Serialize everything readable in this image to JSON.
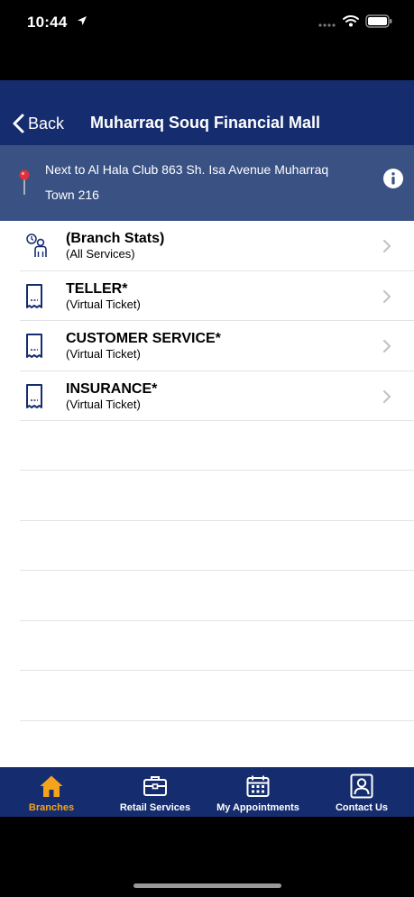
{
  "status": {
    "time": "10:44"
  },
  "nav": {
    "back_label": "Back",
    "title": "Muharraq Souq Financial Mall"
  },
  "address": {
    "text": "Next to Al Hala Club 863 Sh. Isa Avenue Muharraq Town 216"
  },
  "services": [
    {
      "title": "(Branch Stats)",
      "subtitle": "(All Services)",
      "icon": "branch-stats-icon"
    },
    {
      "title": "TELLER*",
      "subtitle": "(Virtual Ticket)",
      "icon": "ticket-icon"
    },
    {
      "title": "CUSTOMER SERVICE*",
      "subtitle": "(Virtual Ticket)",
      "icon": "ticket-icon"
    },
    {
      "title": "INSURANCE*",
      "subtitle": "(Virtual Ticket)",
      "icon": "ticket-icon"
    }
  ],
  "tabs": [
    {
      "label": "Branches",
      "icon": "home-icon",
      "active": true
    },
    {
      "label": "Retail Services",
      "icon": "briefcase-icon",
      "active": false
    },
    {
      "label": "My Appointments",
      "icon": "calendar-icon",
      "active": false
    },
    {
      "label": "Contact Us",
      "icon": "contact-card-icon",
      "active": false
    }
  ],
  "colors": {
    "navbar": "#152d6e",
    "address_bar": "#3a5184",
    "tab_active": "#f7a21b",
    "pin": "#e0303a"
  }
}
